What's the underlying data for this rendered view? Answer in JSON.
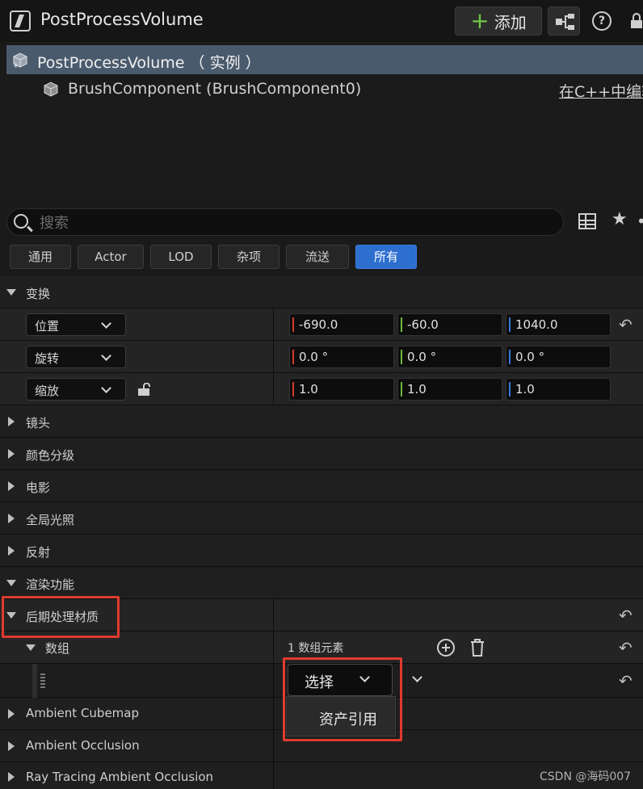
{
  "header": {
    "title": "PostProcessVolume",
    "add_label": "添加"
  },
  "tree": {
    "root_label": "PostProcessVolume （ 实例 ）",
    "child_label": "BrushComponent (BrushComponent0)",
    "edit_link": "在C++中编辑"
  },
  "search": {
    "placeholder": "搜索"
  },
  "tabs": [
    "通用",
    "Actor",
    "LOD",
    "杂项",
    "流送",
    "所有"
  ],
  "active_tab": "所有",
  "transform": {
    "label": "变换",
    "location": {
      "label": "位置",
      "x": "-690.0",
      "y": "-60.0",
      "z": "1040.0"
    },
    "rotation": {
      "label": "旋转",
      "x": "0.0 °",
      "y": "0.0 °",
      "z": "0.0 °"
    },
    "scale": {
      "label": "缩放",
      "x": "1.0",
      "y": "1.0",
      "z": "1.0"
    }
  },
  "axis_colors": {
    "x": "#d13b2e",
    "y": "#6cb83a",
    "z": "#3a78d8"
  },
  "categories": {
    "lens": "镜头",
    "color_grading": "颜色分级",
    "film": "电影",
    "gi": "全局光照",
    "reflection": "反射",
    "rendering": "渲染功能",
    "pp_materials": "后期处理材质",
    "array": "数组",
    "array_count": "1 数组元素",
    "ambient_cubemap": "Ambient Cubemap",
    "ambient_occlusion": "Ambient Occlusion",
    "rt_ao": "Ray Tracing Ambient Occlusion"
  },
  "select_dropdown": {
    "label": "选择",
    "option": "资产引用"
  },
  "watermark": "CSDN @海码007",
  "highlight_color": "#e03a2e"
}
